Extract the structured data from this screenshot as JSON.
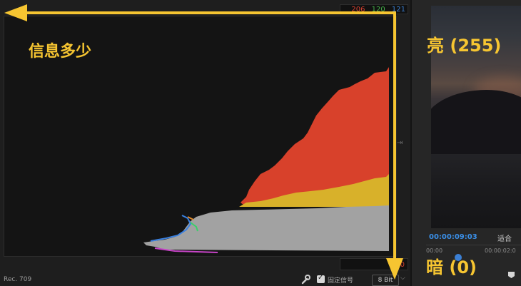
{
  "scopes": {
    "readout": {
      "r": "206",
      "g": "120",
      "b": "121"
    },
    "bottom_readout": "0",
    "footer": {
      "colorspace": "Rec. 709",
      "lock_label": "固定信号",
      "lock_checked": true,
      "bitdepth": "8 Bit"
    }
  },
  "chart_data": {
    "type": "area",
    "orientation": "horizontal histogram (luminance vertical, count horizontal)",
    "ylim": [
      0,
      255
    ],
    "series": [
      {
        "color": "#d8412b",
        "values": [
          [
            232,
            205
          ],
          [
            215,
            170
          ],
          [
            200,
            130
          ],
          [
            180,
            100
          ],
          [
            160,
            60
          ],
          [
            140,
            30
          ],
          [
            120,
            0
          ]
        ]
      },
      {
        "color": "#d9b32a",
        "values": [
          [
            120,
            205
          ],
          [
            110,
            160
          ],
          [
            100,
            100
          ],
          [
            95,
            0
          ]
        ]
      },
      {
        "color": "#a3a3a3",
        "values": [
          [
            95,
            205
          ],
          [
            80,
            140
          ],
          [
            60,
            100
          ],
          [
            40,
            60
          ],
          [
            20,
            20
          ]
        ]
      }
    ]
  },
  "monitor": {
    "timecode": "00:00:09:03",
    "fit": "适合",
    "ruler": [
      "00:00",
      "00:00:02:0"
    ]
  },
  "annotations": {
    "info": "信息多少",
    "bright": "亮 (255)",
    "dark": "暗 (0)"
  },
  "colors": {
    "annotation": "#f6c531",
    "timecode": "#3a8fe8"
  }
}
